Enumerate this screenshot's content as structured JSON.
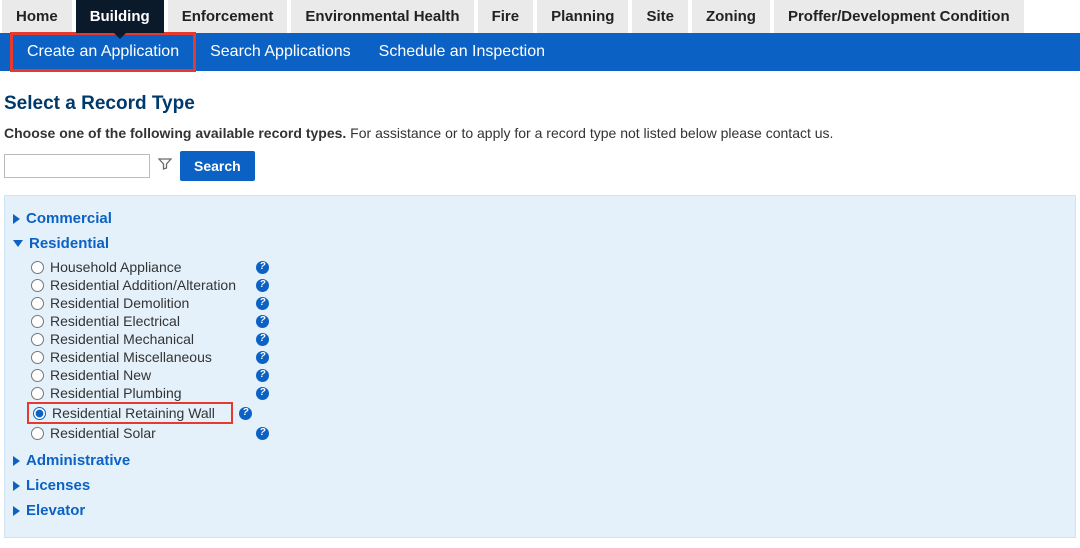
{
  "topnav": {
    "tabs": [
      "Home",
      "Building",
      "Enforcement",
      "Environmental Health",
      "Fire",
      "Planning",
      "Site",
      "Zoning",
      "Proffer/Development Condition"
    ],
    "active_index": 1
  },
  "subnav": {
    "items": [
      "Create an Application",
      "Search Applications",
      "Schedule an Inspection"
    ],
    "highlight_index": 0
  },
  "page_title": "Select a Record Type",
  "intro_bold": "Choose one of the following available record types.",
  "intro_rest": " For assistance or to apply for a record type not listed below please contact us.",
  "search": {
    "button": "Search",
    "value": ""
  },
  "groups": [
    {
      "name": "Commercial",
      "expanded": false,
      "options": []
    },
    {
      "name": "Residential",
      "expanded": true,
      "options": [
        "Household Appliance",
        "Residential Addition/Alteration",
        "Residential Demolition",
        "Residential Electrical",
        "Residential Mechanical",
        "Residential Miscellaneous",
        "Residential New",
        "Residential Plumbing",
        "Residential Retaining Wall",
        "Residential Solar"
      ],
      "selected_index": 8,
      "highlight_index": 8
    },
    {
      "name": "Administrative",
      "expanded": false,
      "options": []
    },
    {
      "name": "Licenses",
      "expanded": false,
      "options": []
    },
    {
      "name": "Elevator",
      "expanded": false,
      "options": []
    }
  ]
}
